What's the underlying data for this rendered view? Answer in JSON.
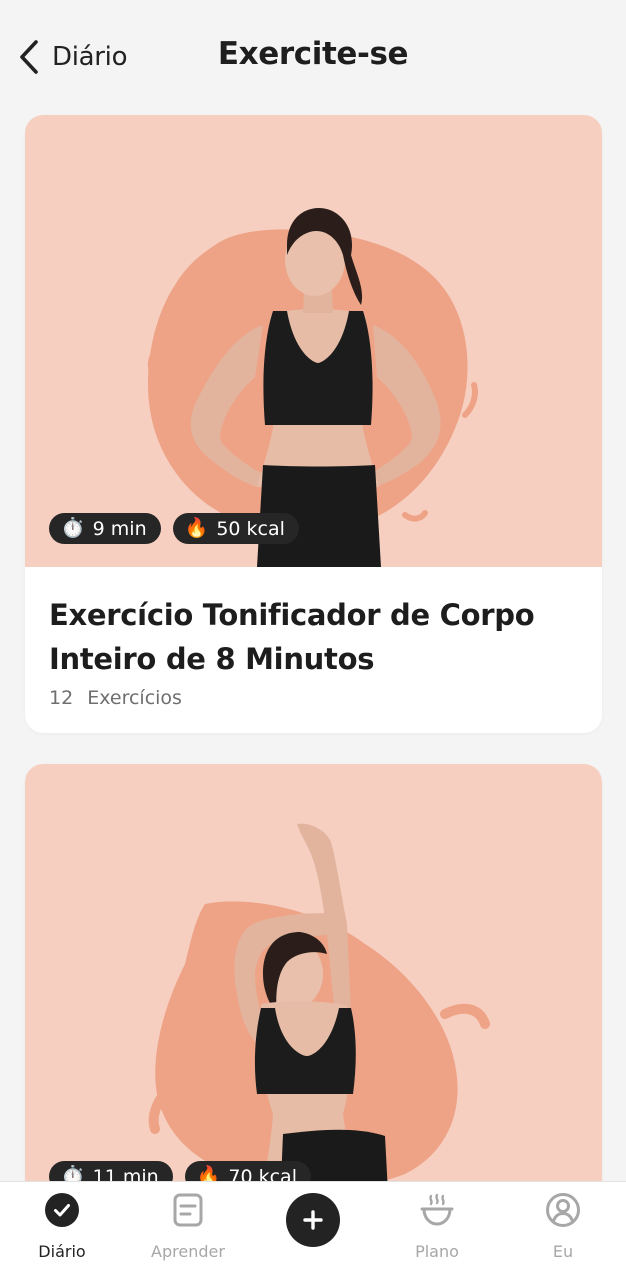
{
  "header": {
    "back_label": "Diário",
    "title": "Exercite-se"
  },
  "workouts": [
    {
      "duration": "9 min",
      "calories": "50 kcal",
      "title_line1": "Exercício Tonificador de Corpo",
      "title_line2": "Inteiro de 8 Minutos",
      "exercise_count": "12",
      "exercise_label": "Exercícios"
    },
    {
      "duration": "11 min",
      "calories": "70 kcal"
    }
  ],
  "icons": {
    "timer": "⏱️",
    "fire": "🔥"
  },
  "tabbar": {
    "items": [
      {
        "label": "Diário",
        "icon": "check-circle-icon",
        "active": true
      },
      {
        "label": "Aprender",
        "icon": "document-icon",
        "active": false
      },
      {
        "label": "",
        "icon": "plus-icon",
        "active": false
      },
      {
        "label": "Plano",
        "icon": "bowl-icon",
        "active": false
      },
      {
        "label": "Eu",
        "icon": "profile-icon",
        "active": false
      }
    ]
  },
  "colors": {
    "background": "#f4f4f4",
    "card_image_bg": "#f6cfc1",
    "splash": "#eea386",
    "chip_bg": "#262626",
    "active_tab": "#222222",
    "inactive_tab": "#a7a7a7"
  }
}
